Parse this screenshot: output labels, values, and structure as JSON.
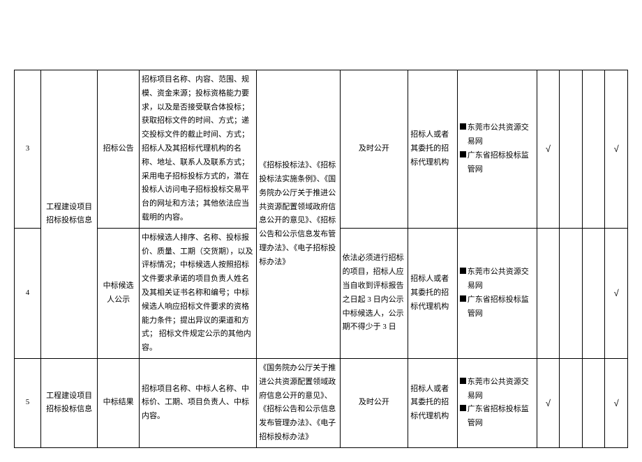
{
  "rows": [
    {
      "idx": "3",
      "category": "工程建设项目招标投标信息",
      "sub": "招标公告",
      "content": "招标项目名称、内容、范围、规模、资金来源；投标资格能力要求，以及是否接受联合体投标；获取招标文件的时间、方式；递交投标文件的截止时间、方式；招标人及其招标代理机构的名称、地址、联系人及联系方式；采用电子招标投标方式的，潜在投标人访问电子招标投标交易平台的网址和方法；其他依法应当载明的内容。",
      "basis": "《招标投标法》、《招标投标法实施条例》、《国务院办公厅关于推进公共资源配置领域政府信息公开的意见》、《招标公告和公示信息发布管理办法》、《电子招标投标办法》",
      "time": "及时公开",
      "subject": "招标人或者其委托的招标代理机构",
      "channels": [
        "东莞市公共资源交易网",
        "广东省招标投标监管网"
      ],
      "checks": [
        "√",
        "",
        "",
        "√"
      ]
    },
    {
      "idx": "4",
      "sub": "中标候选人公示",
      "content": "中标候选人排序、名称、投标报价、质量、工期（交货期），以及评标情况；中标候选人按照招标文件要求承诺的项目负责人姓名及其相关证书名称和编号；中标候选人响应招标文件要求的资格能力条件；提出异议的渠道和方式；\n招标文件规定公示的其他内容。",
      "time": "依法必须进行招标的项目，招标人应当自收到评标报告之日起 3 日内公示中标候选人，公示期不得少于 3 日",
      "subject": "招标人或者其委托的招标代理机构",
      "channels": [
        "东莞市公共资源交易网",
        "广东省招标投标监管网"
      ],
      "checks": [
        "",
        "",
        "",
        "√"
      ]
    },
    {
      "idx": "5",
      "category": "工程建设项目招标投标信息",
      "sub": "中标结果",
      "content": "招标项目名称、中标人名称、中标价、工期、项目负责人、中标内容。",
      "basis": "《国务院办公厅关于推进公共资源配置领域政府信息公开的意见》、《招标公告和公示信息发布管理办法》、《电子招标投标办法》",
      "time": "及时公开",
      "subject": "招标人或者其委托的招标代理机构",
      "channels": [
        "东莞市公共资源交易网",
        "广东省招标投标监管网"
      ],
      "checks": [
        "√",
        "",
        "",
        "√"
      ]
    }
  ]
}
